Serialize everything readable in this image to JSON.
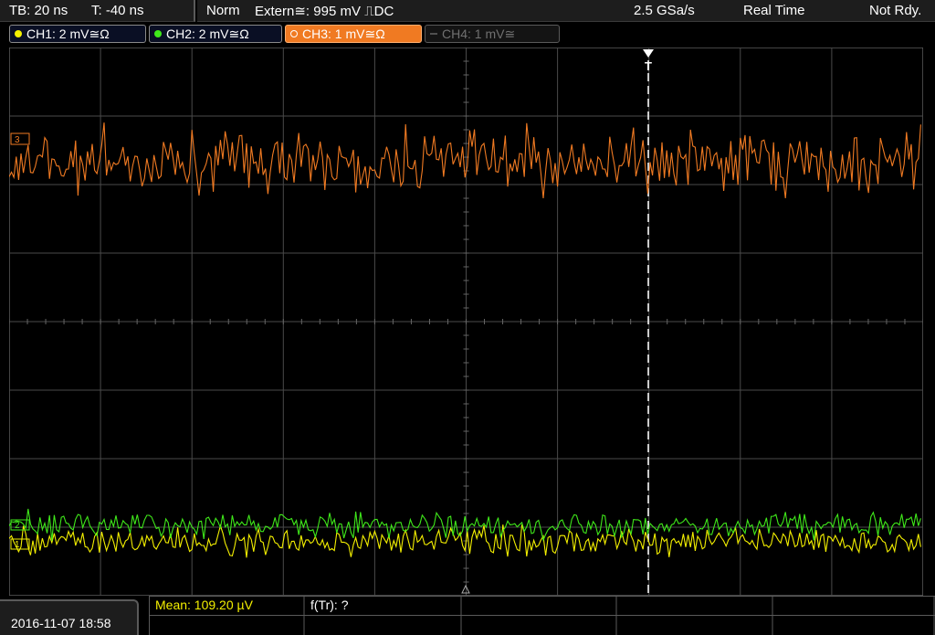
{
  "header": {
    "timebase": "TB: 20 ns",
    "trigger_time": "T: -40 ns",
    "mode": "Norm",
    "trigger_source": "Extern≅: 995 mV ⎍DC",
    "sample_rate": "2.5 GSa/s",
    "acq_mode": "Real Time",
    "status": "Not Rdy."
  },
  "channels": [
    {
      "id": "CH1",
      "label": "CH1: 2 mV≅Ω",
      "color": "#f4f000",
      "active": true
    },
    {
      "id": "CH2",
      "label": "CH2: 2 mV≅Ω",
      "color": "#3fe81a",
      "active": true
    },
    {
      "id": "CH3",
      "label": "CH3: 1 mV≅Ω",
      "color": "#f07a22",
      "active": true,
      "selected": true
    },
    {
      "id": "CH4",
      "label": "CH4: 1 mV≅",
      "color": "#707070",
      "active": false
    }
  ],
  "markers": {
    "ch3": "3",
    "ch2": "2",
    "ch1": "1",
    "trigger": "T"
  },
  "footer": {
    "datetime": "2016-11-07 18:58",
    "mean": "Mean: 109.20 µV",
    "ftr": "f(Tr): ?"
  },
  "colors": {
    "ch1": "#f4f000",
    "ch2": "#3fe81a",
    "ch3": "#f07a22",
    "grid": "#4a4a4a"
  }
}
